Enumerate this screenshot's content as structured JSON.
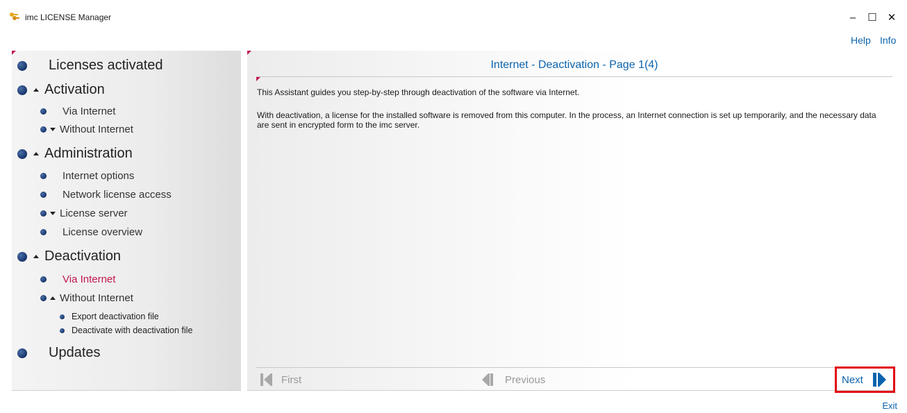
{
  "window": {
    "title": "imc LICENSE Manager",
    "minimize": "–",
    "maximize": "☐",
    "close": "✕"
  },
  "toplinks": {
    "help": "Help",
    "info": "Info"
  },
  "nav": {
    "licenses_activated": "Licenses activated",
    "activation": "Activation",
    "activation_via_internet": "Via Internet",
    "activation_without_internet": "Without Internet",
    "administration": "Administration",
    "internet_options": "Internet options",
    "network_license_access": "Network license access",
    "license_server": "License server",
    "license_overview": "License overview",
    "deactivation": "Deactivation",
    "deactivation_via_internet": "Via Internet",
    "deactivation_without_internet": "Without Internet",
    "export_deactivation_file": "Export deactivation file",
    "deactivate_with_file": "Deactivate with deactivation file",
    "updates": "Updates"
  },
  "content": {
    "page_title": "Internet - Deactivation - Page 1(4)",
    "para1": "This Assistant guides you step-by-step through deactivation of the software via Internet.",
    "para2": "With deactivation, a license for the installed software is removed from this computer. In the process, an Internet connection is set up temporarily, and the necessary data are sent in encrypted form to the imc server."
  },
  "footer": {
    "first": "First",
    "previous": "Previous",
    "next": "Next"
  },
  "exit": "Exit",
  "colors": {
    "accent_blue": "#0b63ad",
    "active_red": "#c2184b",
    "highlight_box": "#e30613"
  }
}
